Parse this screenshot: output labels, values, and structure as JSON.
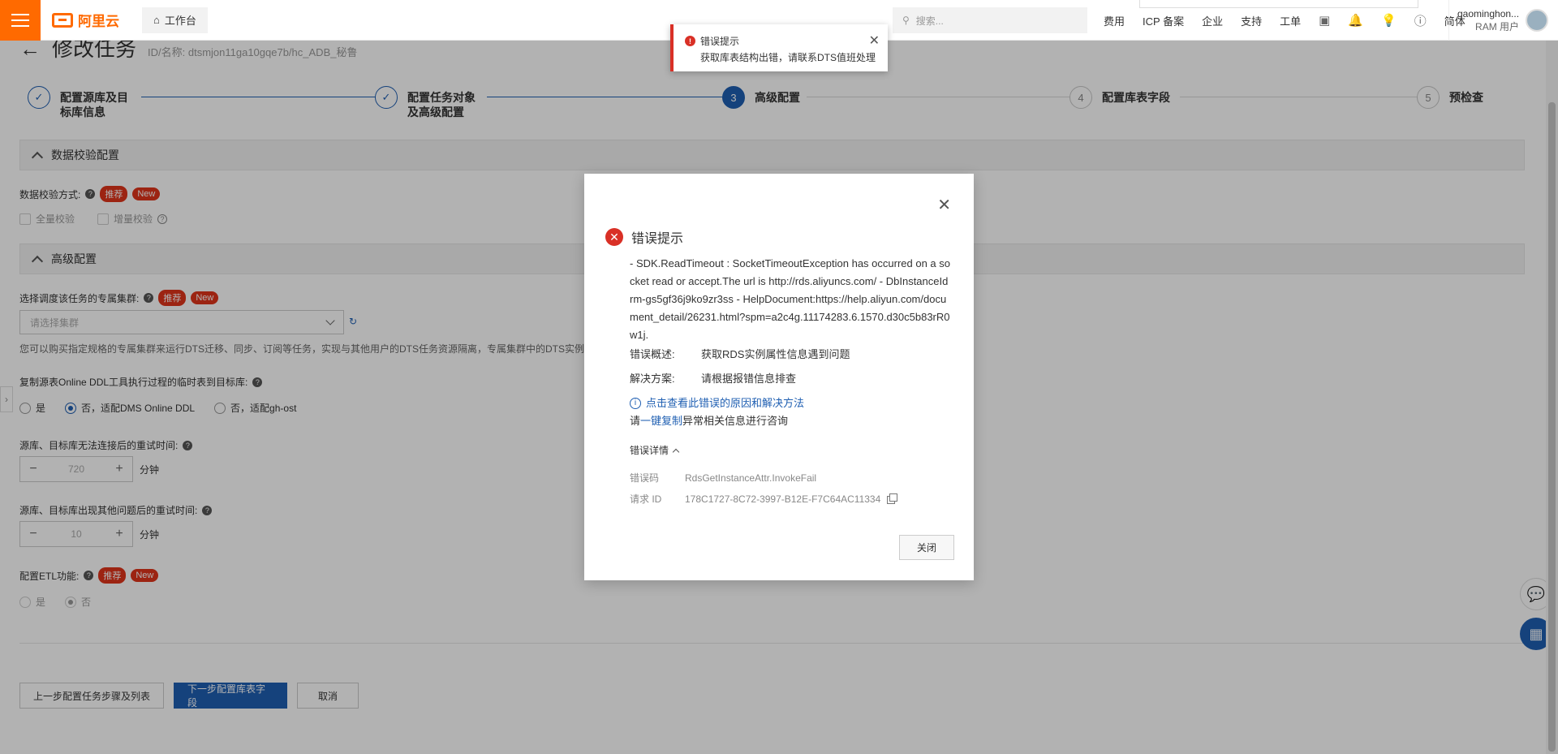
{
  "topbar": {
    "logo_text": "阿里云",
    "workbench": "工作台",
    "search_placeholder": "搜索...",
    "links": [
      "费用",
      "ICP 备案",
      "企业",
      "支持",
      "工单"
    ],
    "lang": "简体",
    "user_name": "gaominghon...",
    "user_role": "RAM 用户"
  },
  "page": {
    "title": "修改任务",
    "id_text": "ID/名称: dtsmjon11ga10gqe7b/hc_ADB_秘鲁"
  },
  "steps": [
    {
      "num": "✓",
      "label_line1": "配置源库及目",
      "label_line2": "标库信息",
      "state": "done"
    },
    {
      "num": "✓",
      "label_line1": "配置任务对象",
      "label_line2": "及高级配置",
      "state": "done"
    },
    {
      "num": "3",
      "label_line1": "高级配置",
      "label_line2": "",
      "state": "active"
    },
    {
      "num": "4",
      "label_line1": "配置库表字段",
      "label_line2": "",
      "state": "todo"
    },
    {
      "num": "5",
      "label_line1": "预检查",
      "label_line2": "",
      "state": "todo"
    }
  ],
  "sections": {
    "validation": "数据校验配置",
    "advanced": "高级配置"
  },
  "validation": {
    "label": "数据校验方式:",
    "badge_recommend": "推荐",
    "badge_new": "New",
    "full_check": "全量校验",
    "incr_check": "增量校验"
  },
  "cluster": {
    "label": "选择调度该任务的专属集群:",
    "placeholder": "请选择集群",
    "desc": "您可以购买指定规格的专属集群来运行DTS迁移、同步、订阅等任务，实现与其他用户的DTS任务资源隔离，专属集群中的DTS实例相"
  },
  "online_ddl": {
    "label": "复制源表Online DDL工具执行过程的临时表到目标库:",
    "options": [
      "是",
      "否，适配DMS Online DDL",
      "否，适配gh-ost"
    ]
  },
  "retry1": {
    "label": "源库、目标库无法连接后的重试时间:",
    "value": "720",
    "unit": "分钟"
  },
  "retry2": {
    "label": "源库、目标库出现其他问题后的重试时间:",
    "value": "10",
    "unit": "分钟"
  },
  "etl": {
    "label": "配置ETL功能:",
    "options": [
      "是",
      "否"
    ]
  },
  "buttons": {
    "prev": "上一步配置任务步骤及列表",
    "next": "下一步配置库表字段",
    "cancel": "取消"
  },
  "toast": {
    "title": "错误提示",
    "message": "获取库表结构出错，请联系DTS值班处理"
  },
  "dialog": {
    "title": "错误提示",
    "message": "- SDK.ReadTimeout : SocketTimeoutException has occurred on a socket read or accept.The url is http://rds.aliyuncs.com/ - DbInstanceId rm-gs5gf36j9ko9zr3ss - HelpDocument:https://help.aliyun.com/document_detail/26231.html?spm=a2c4g.11174283.6.1570.d30c5b83rR0w1j.",
    "summary_key": "错误概述:",
    "summary_val": "获取RDS实例属性信息遇到问题",
    "solution_key": "解决方案:",
    "solution_val": "请根据报错信息排查",
    "help_link": "点击查看此错误的原因和解决方法",
    "copy_prefix": "请",
    "copy_link": "一键复制",
    "copy_suffix": "异常相关信息进行咨询",
    "detail_toggle": "错误详情",
    "code_key": "错误码",
    "code_val": "RdsGetInstanceAttr.InvokeFail",
    "reqid_key": "请求 ID",
    "reqid_val": "178C1727-8C72-3997-B12E-F7C64AC11334",
    "close_btn": "关闭"
  },
  "colors": {
    "brand": "#ff6a00",
    "primary": "#1f5fb2",
    "error": "#d93026"
  }
}
